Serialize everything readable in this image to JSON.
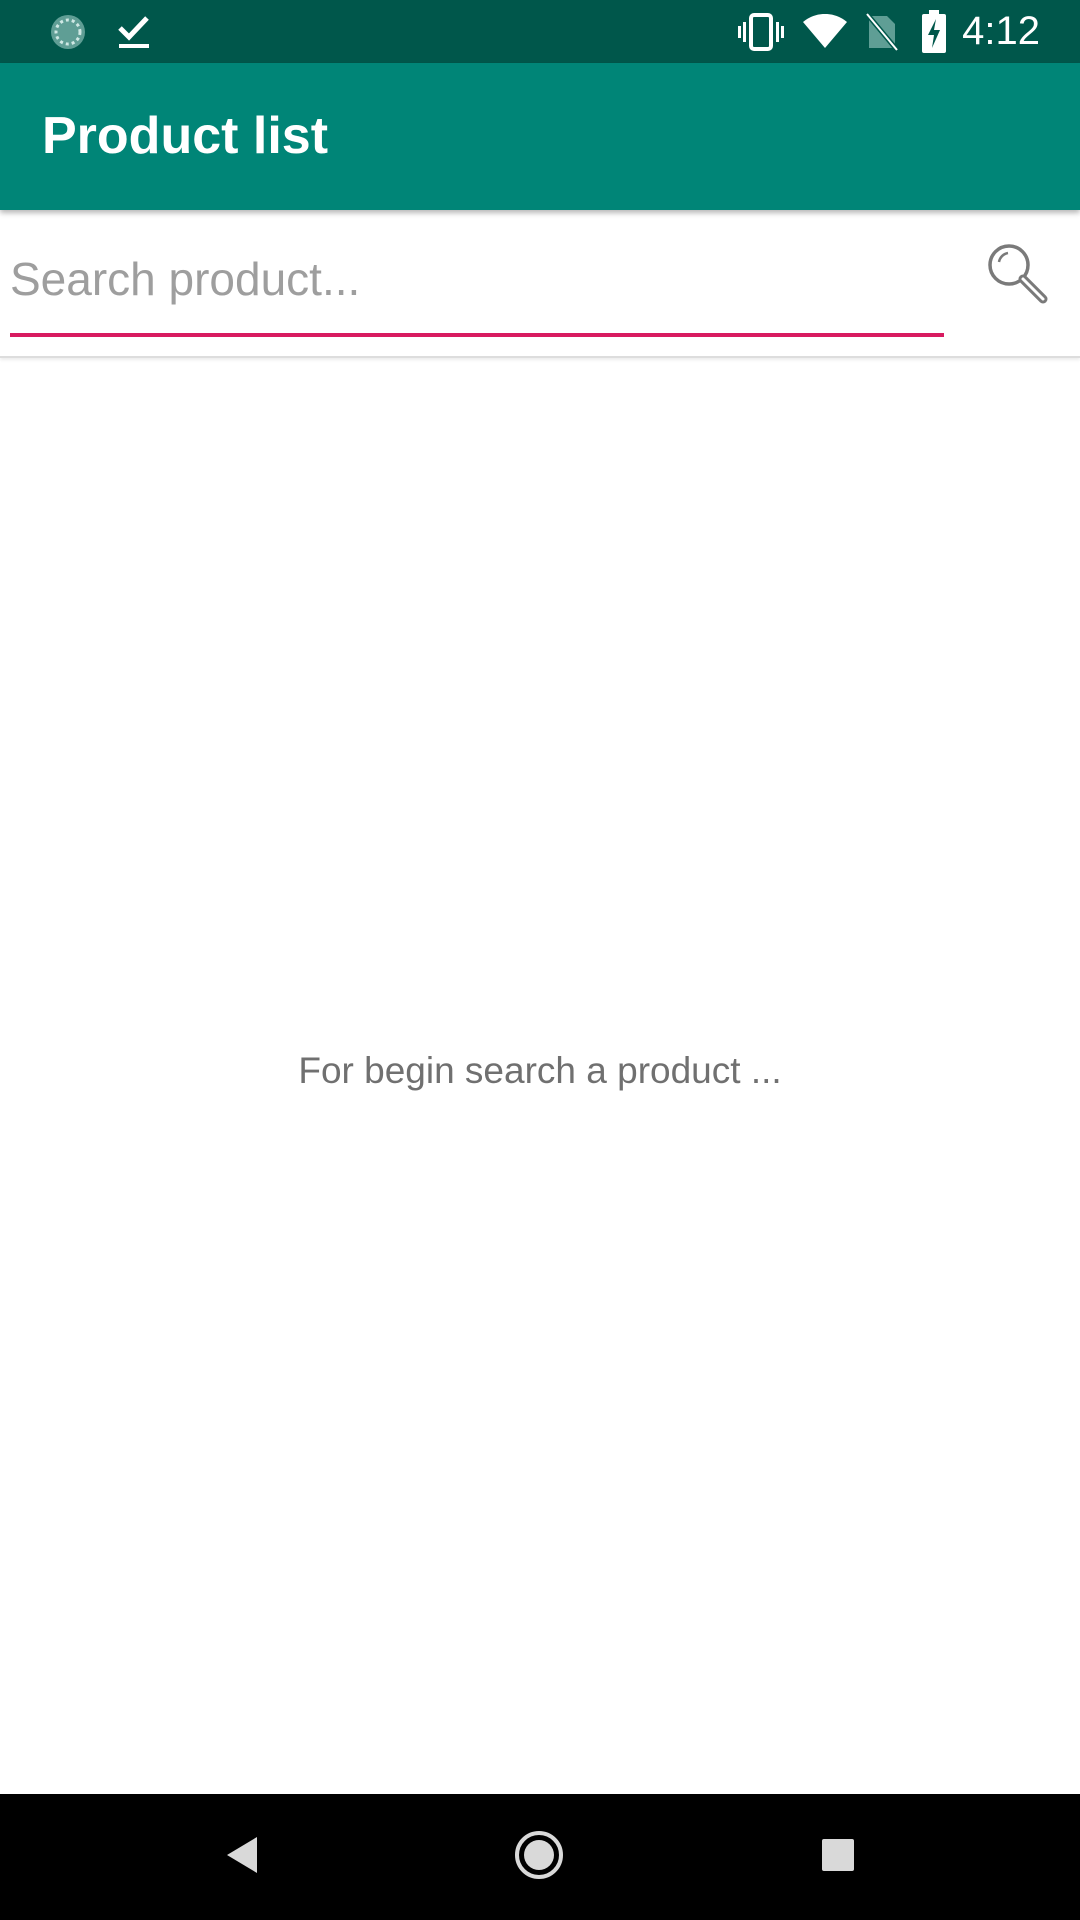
{
  "status_bar": {
    "time": "4:12",
    "background": "#00574b",
    "left_icons": [
      "sync-icon",
      "download-done-icon"
    ],
    "right_icons": [
      "vibrate-icon",
      "wifi-icon",
      "no-sim-icon",
      "battery-charging-icon"
    ]
  },
  "app_bar": {
    "title": "Product list",
    "background": "#008577"
  },
  "search": {
    "placeholder": "Search product...",
    "value": "",
    "underline_color": "#d81b60",
    "button_icon": "search-icon"
  },
  "main": {
    "empty_message": "For begin search a product ..."
  },
  "nav_bar": {
    "buttons": [
      "back-icon",
      "home-icon",
      "recents-icon"
    ]
  }
}
